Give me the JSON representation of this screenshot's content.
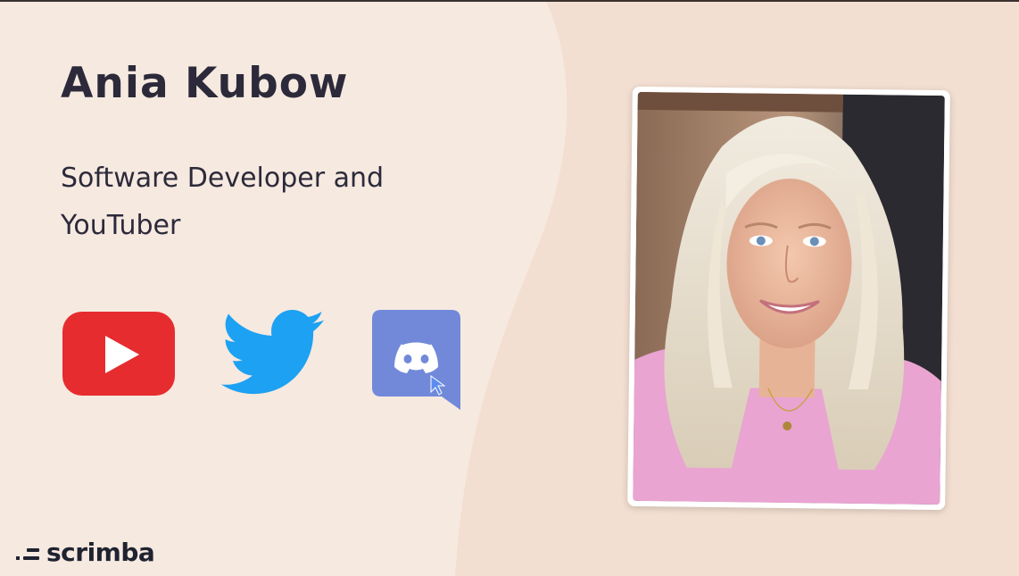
{
  "profile": {
    "name": "Ania Kubow",
    "subtitle": "Software Developer and YouTuber"
  },
  "social": [
    {
      "icon": "youtube-icon",
      "color": "#e62c2f"
    },
    {
      "icon": "twitter-icon",
      "color": "#1da1f2"
    },
    {
      "icon": "discord-icon",
      "color": "#7289da"
    }
  ],
  "brand": {
    "logo_text": "scrimba"
  },
  "colors": {
    "background_left": "#f6e9e0",
    "background_right": "#f3dfd1",
    "text": "#2c2a3a"
  }
}
